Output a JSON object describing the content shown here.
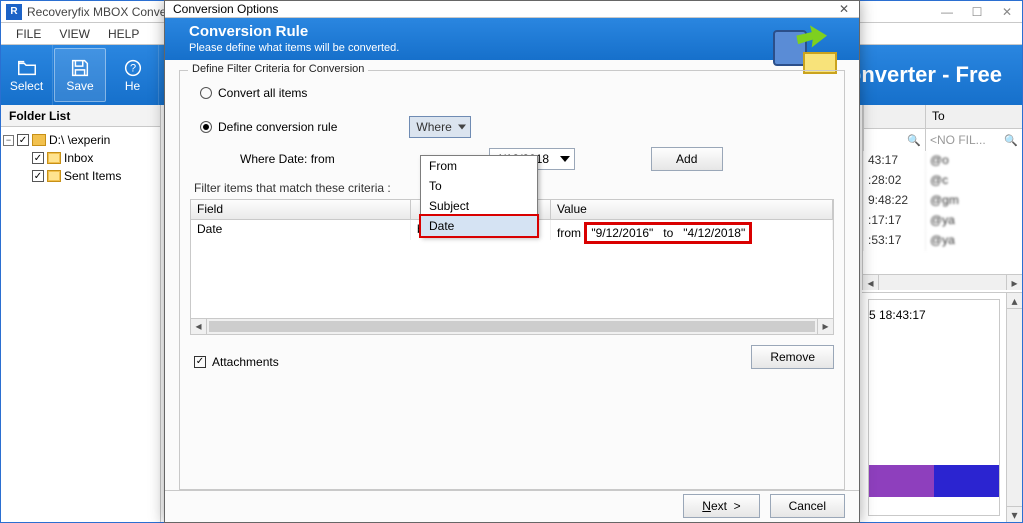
{
  "app": {
    "title": "Recoveryfix MBOX Conve",
    "brand": "Converter - Free"
  },
  "menus": {
    "file": "FILE",
    "view": "VIEW",
    "help": "HELP"
  },
  "toolbar": {
    "select": "Select",
    "save": "Save",
    "help": "He"
  },
  "folder_panel": {
    "title": "Folder List",
    "root": "D:\\         \\experin",
    "items": [
      "Inbox",
      "Sent Items"
    ]
  },
  "mail_list": {
    "col_to": "To",
    "filter_placeholder": "<NO FIL...",
    "rows": [
      {
        "time": "43:17",
        "to": "@o"
      },
      {
        "time": ":28:02",
        "to": "@c"
      },
      {
        "time": "9:48:22",
        "to": "@gm"
      },
      {
        "time": ":17:17",
        "to": "@ya"
      },
      {
        "time": ":53:17",
        "to": "@ya"
      }
    ]
  },
  "preview": {
    "datetime_fragment": "5 18:43:17"
  },
  "dialog": {
    "title": "Conversion Options",
    "banner_title": "Conversion Rule",
    "banner_sub": "Please define what items will be converted.",
    "group_legend": "Define Filter Criteria for Conversion",
    "opt_all": "Convert all items",
    "opt_rule": "Define conversion rule",
    "where_btn": "Where",
    "where_label": "Where  Date:  from",
    "to_label": "to",
    "date_to": "4/12/2018",
    "add": "Add",
    "dropdown": {
      "from": "From",
      "to": "To",
      "subject": "Subject",
      "date": "Date"
    },
    "filter_label": "Filter items that match these criteria :",
    "cols": {
      "field": "Field",
      "value": "Value"
    },
    "row": {
      "field": "Date",
      "op_fragment": "between",
      "val_prefix": "from",
      "val_from": "\"9/12/2016\"",
      "val_mid": "to",
      "val_to": "\"4/12/2018\""
    },
    "attachments": "Attachments",
    "remove": "Remove",
    "next": "Next >",
    "cancel": "Cancel"
  }
}
